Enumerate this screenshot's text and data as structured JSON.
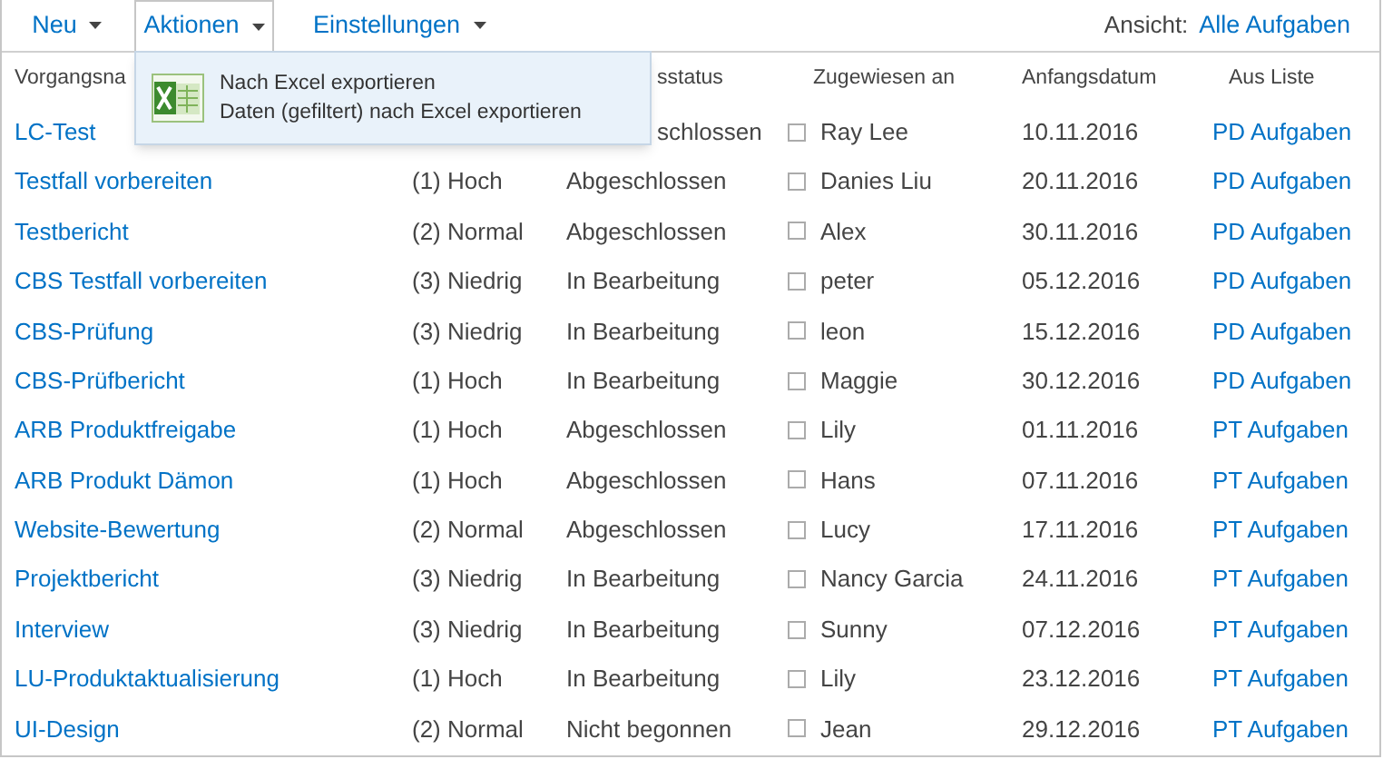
{
  "toolbar": {
    "items": [
      {
        "label": "Neu",
        "selected": false
      },
      {
        "label": "Aktionen",
        "selected": true
      },
      {
        "label": "Einstellungen",
        "selected": false
      }
    ],
    "view_label": "Ansicht:",
    "view": "Alle Aufgaben"
  },
  "menu": {
    "items": [
      "Nach Excel exportieren",
      "Daten (gefiltert) nach Excel exportieren"
    ]
  },
  "table": {
    "columns": [
      "Vorgangsna",
      "",
      "sstatus",
      "Zugewiesen an",
      "Anfangsdatum",
      "Aus Liste"
    ],
    "rows": [
      {
        "name": "LC-Test",
        "status": "schlossen",
        "assignee": "Ray Lee",
        "checked": false,
        "start": "10.11.2016",
        "list": "PD Aufgaben"
      },
      {
        "name": "Testfall vorbereiten",
        "priority": "(1) Hoch",
        "status": "Abgeschlossen",
        "assignee": "Danies Liu",
        "checked": false,
        "start": "20.11.2016",
        "list": "PD Aufgaben"
      },
      {
        "name": "Testbericht",
        "priority": "(2) Normal",
        "status": "Abgeschlossen",
        "assignee": "Alex",
        "checked": false,
        "start": "30.11.2016",
        "list": "PD Aufgaben"
      },
      {
        "name": "CBS Testfall vorbereiten",
        "priority": "(3) Niedrig",
        "status": "In Bearbeitung",
        "assignee": "peter",
        "checked": false,
        "start": "05.12.2016",
        "list": "PD Aufgaben"
      },
      {
        "name": "CBS-Prüfung",
        "priority": "(3) Niedrig",
        "status": "In Bearbeitung",
        "assignee": "leon",
        "checked": false,
        "start": "15.12.2016",
        "list": "PD Aufgaben"
      },
      {
        "name": "CBS-Prüfbericht",
        "priority": "(1) Hoch",
        "status": "In Bearbeitung",
        "assignee": "Maggie",
        "checked": false,
        "start": "30.12.2016",
        "list": "PD Aufgaben"
      },
      {
        "name": "ARB Produktfreigabe",
        "priority": "(1) Hoch",
        "status": "Abgeschlossen",
        "assignee": "Lily",
        "checked": false,
        "start": "01.11.2016",
        "list": "PT Aufgaben"
      },
      {
        "name": "ARB Produkt Dämon",
        "priority": "(1) Hoch",
        "status": "Abgeschlossen",
        "assignee": "Hans",
        "checked": false,
        "start": "07.11.2016",
        "list": "PT Aufgaben"
      },
      {
        "name": "Website-Bewertung",
        "priority": "(2) Normal",
        "status": "Abgeschlossen",
        "assignee": "Lucy",
        "checked": false,
        "start": "17.11.2016",
        "list": "PT Aufgaben"
      },
      {
        "name": "Projektbericht",
        "priority": "(3) Niedrig",
        "status": "In Bearbeitung",
        "assignee": "Nancy Garcia",
        "checked": false,
        "start": "24.11.2016",
        "list": "PT Aufgaben"
      },
      {
        "name": "Interview",
        "priority": "(3) Niedrig",
        "status": "In Bearbeitung",
        "assignee": "Sunny",
        "checked": false,
        "start": "07.12.2016",
        "list": "PT Aufgaben"
      },
      {
        "name": "LU-Produktaktualisierung",
        "priority": "(1) Hoch",
        "status": "In Bearbeitung",
        "assignee": "Lily",
        "checked": false,
        "start": "23.12.2016",
        "list": "PT Aufgaben"
      },
      {
        "name": "UI-Design",
        "priority": "(2) Normal",
        "status": "Nicht begonnen",
        "assignee": "Jean",
        "checked": false,
        "start": "29.12.2016",
        "list": "PT Aufgaben"
      }
    ]
  }
}
